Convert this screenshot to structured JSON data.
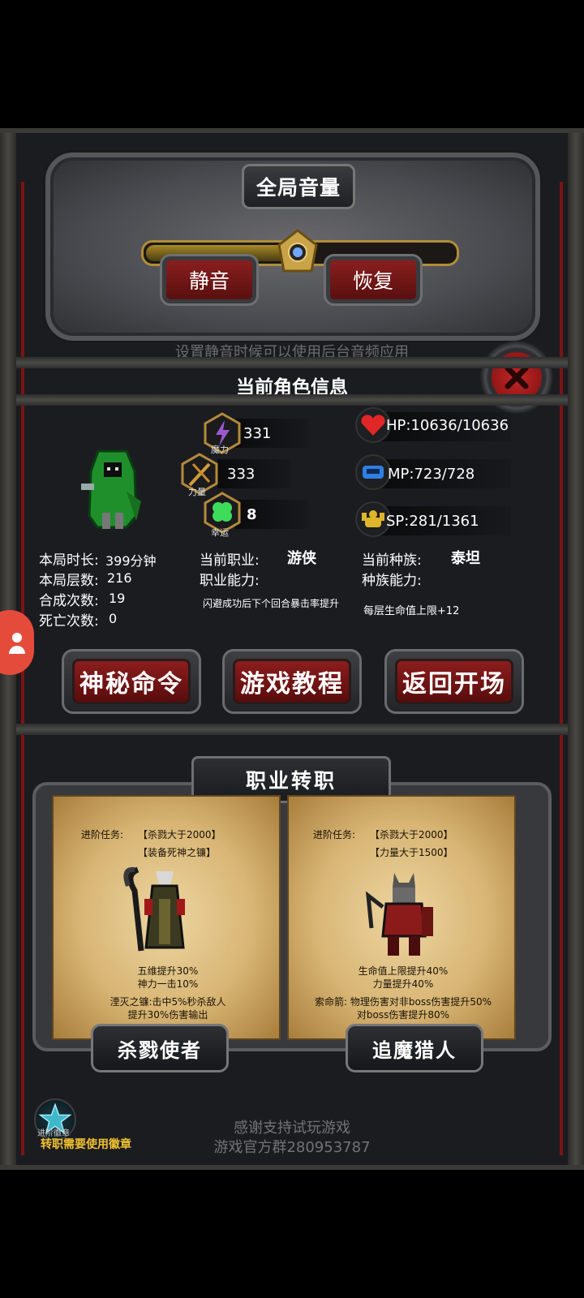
{
  "volume": {
    "title": "全局音量",
    "level_percent": 50,
    "mute_label": "静音",
    "restore_label": "恢复",
    "hint": "设置静音时候可以使用后台音频应用"
  },
  "character": {
    "section_title": "当前角色信息",
    "stats": {
      "magic_label": "魔力",
      "magic_value": "331",
      "strength_label": "力量",
      "strength_value": "333",
      "luck_label": "幸运",
      "luck_value": "8",
      "hp": "HP:10636/10636",
      "mp": "MP:723/728",
      "sp": "SP:281/1361"
    },
    "info": {
      "duration_label": "本局时长:",
      "duration_value": "399分钟",
      "floors_label": "本局层数:",
      "floors_value": "216",
      "synth_label": "合成次数:",
      "synth_value": "19",
      "death_label": "死亡次数:",
      "death_value": "0",
      "class_label": "当前职业:",
      "class_value": "游侠",
      "class_ability_label": "职业能力:",
      "class_ability_value": "闪避成功后下个回合暴击率提升",
      "race_label": "当前种族:",
      "race_value": "泰坦",
      "race_ability_label": "种族能力:",
      "race_ability_value": "每层生命值上限+12"
    },
    "buttons": {
      "secret": "神秘命令",
      "tutorial": "游戏教程",
      "back": "返回开场"
    }
  },
  "class_change": {
    "title": "职业转职",
    "cards": [
      {
        "task_label": "进阶任务:",
        "req1": "【杀戮大于2000】",
        "req2": "【装备死神之镰】",
        "bonus1": "五维提升30%",
        "bonus2": "神力一击10%",
        "skill1": "湮灭之镰:击中5%秒杀敌人",
        "skill2": "提升30%伤害输出",
        "name": "杀戮使者"
      },
      {
        "task_label": "进阶任务:",
        "req1": "【杀戮大于2000】",
        "req2": "【力量大于1500】",
        "bonus1": "生命值上限提升40%",
        "bonus2": "力量提升40%",
        "skill1": "索命箭: 物理伤害对非boss伤害提升50%",
        "skill2": "对boss伤害提升80%",
        "name": "追魔猎人"
      }
    ],
    "badge_label": "进阶徽章",
    "badge_note": "转职需要使用徽章"
  },
  "footer": {
    "line1": "感谢支持试玩游戏",
    "line2": "游戏官方群280953787"
  },
  "colors": {
    "accent_red": "#8c1d1d",
    "gold": "#b08d3a",
    "note_yellow": "#f1c232"
  }
}
